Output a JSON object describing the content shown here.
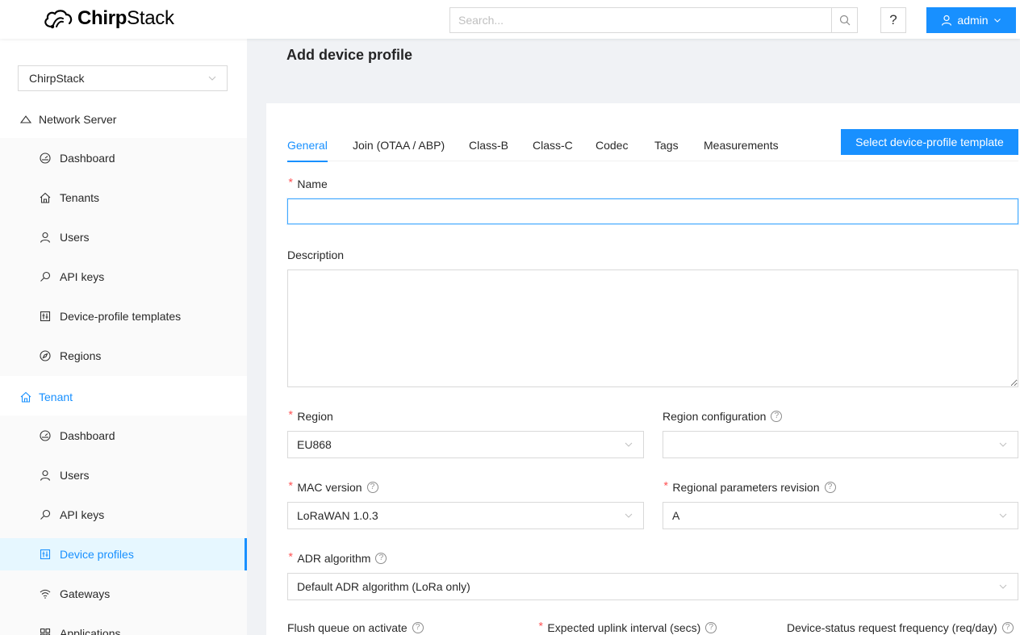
{
  "header": {
    "logo_bold": "Chirp",
    "logo_regular": "Stack",
    "search_placeholder": "Search...",
    "help_label": "?",
    "user_label": "admin"
  },
  "sidebar": {
    "tenant_select": "ChirpStack",
    "network_server": {
      "label": "Network Server",
      "items": [
        {
          "label": "Dashboard",
          "icon": "dashboard-icon"
        },
        {
          "label": "Tenants",
          "icon": "home-icon"
        },
        {
          "label": "Users",
          "icon": "user-icon"
        },
        {
          "label": "API keys",
          "icon": "key-icon"
        },
        {
          "label": "Device-profile templates",
          "icon": "control-icon"
        },
        {
          "label": "Regions",
          "icon": "compass-icon"
        }
      ]
    },
    "tenant": {
      "label": "Tenant",
      "items": [
        {
          "label": "Dashboard",
          "icon": "dashboard-icon"
        },
        {
          "label": "Users",
          "icon": "user-icon"
        },
        {
          "label": "API keys",
          "icon": "key-icon"
        },
        {
          "label": "Device profiles",
          "icon": "control-icon",
          "selected": true
        },
        {
          "label": "Gateways",
          "icon": "wifi-icon"
        },
        {
          "label": "Applications",
          "icon": "appstore-icon"
        }
      ]
    }
  },
  "page": {
    "title": "Add device profile",
    "tabs": [
      "General",
      "Join (OTAA / ABP)",
      "Class-B",
      "Class-C",
      "Codec",
      "Tags",
      "Measurements"
    ],
    "active_tab": "General",
    "template_button": "Select device-profile template"
  },
  "form": {
    "name_label": "Name",
    "name_value": "",
    "description_label": "Description",
    "description_value": "",
    "region_label": "Region",
    "region_value": "EU868",
    "region_config_label": "Region configuration",
    "region_config_value": "",
    "mac_version_label": "MAC version",
    "mac_version_value": "LoRaWAN 1.0.3",
    "reg_params_label": "Regional parameters revision",
    "reg_params_value": "A",
    "adr_label": "ADR algorithm",
    "adr_value": "Default ADR algorithm (LoRa only)",
    "flush_label": "Flush queue on activate",
    "uplink_interval_label": "Expected uplink interval (secs)",
    "dev_status_label": "Device-status request frequency (req/day)"
  },
  "colors": {
    "primary": "#1890ff",
    "required": "#ff4d4f",
    "selected_bg": "#e6f7ff"
  }
}
